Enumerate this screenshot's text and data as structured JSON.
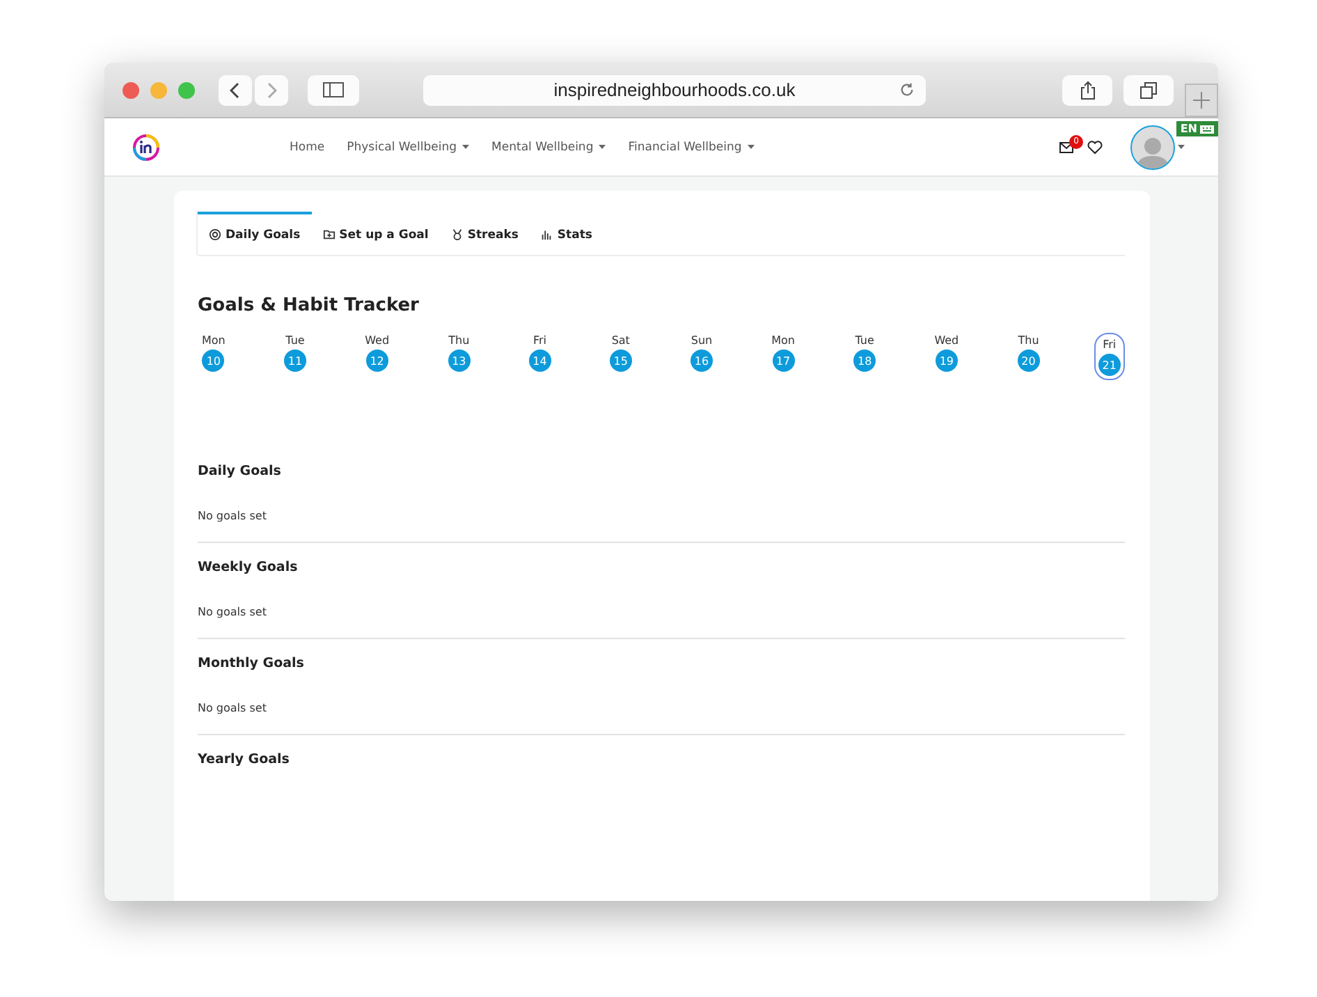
{
  "browser": {
    "url": "inspiredneighbourhoods.co.uk"
  },
  "nav": {
    "items": [
      {
        "label": "Home",
        "kind": "link"
      },
      {
        "label": "Physical Wellbeing",
        "kind": "dropdown"
      },
      {
        "label": "Mental Wellbeing",
        "kind": "dropdown"
      },
      {
        "label": "Financial Wellbeing",
        "kind": "dropdown"
      }
    ],
    "messages_count": "0",
    "language": "EN"
  },
  "tabs": [
    {
      "label": "Daily Goals",
      "selected": true
    },
    {
      "label": "Set up a Goal",
      "selected": false
    },
    {
      "label": "Streaks",
      "selected": false
    },
    {
      "label": "Stats",
      "selected": false
    }
  ],
  "title": "Goals & Habit Tracker",
  "days": [
    {
      "day": "Mon",
      "date": "10",
      "selected": false
    },
    {
      "day": "Tue",
      "date": "11",
      "selected": false
    },
    {
      "day": "Wed",
      "date": "12",
      "selected": false
    },
    {
      "day": "Thu",
      "date": "13",
      "selected": false
    },
    {
      "day": "Fri",
      "date": "14",
      "selected": false
    },
    {
      "day": "Sat",
      "date": "15",
      "selected": false
    },
    {
      "day": "Sun",
      "date": "16",
      "selected": false
    },
    {
      "day": "Mon",
      "date": "17",
      "selected": false
    },
    {
      "day": "Tue",
      "date": "18",
      "selected": false
    },
    {
      "day": "Wed",
      "date": "19",
      "selected": false
    },
    {
      "day": "Thu",
      "date": "20",
      "selected": false
    },
    {
      "day": "Fri",
      "date": "21",
      "selected": true
    }
  ],
  "sections": [
    {
      "heading": "Daily Goals",
      "empty": "No goals set"
    },
    {
      "heading": "Weekly Goals",
      "empty": "No goals set"
    },
    {
      "heading": "Monthly Goals",
      "empty": "No goals set"
    },
    {
      "heading": "Yearly Goals"
    }
  ]
}
